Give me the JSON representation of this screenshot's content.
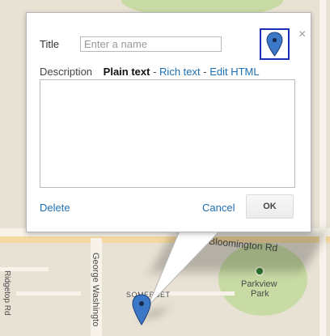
{
  "dialog": {
    "title_label": "Title",
    "title_placeholder": "Enter a name",
    "title_value": "",
    "description_label": "Description",
    "mode_plain": "Plain text",
    "separator": "-",
    "mode_rich": "Rich text",
    "mode_html": "Edit HTML",
    "description_value": "",
    "delete_label": "Delete",
    "cancel_label": "Cancel",
    "ok_label": "OK",
    "close_glyph": "×",
    "marker_icon": "map-pin-icon",
    "close_icon": "close-icon"
  },
  "map": {
    "labels": {
      "bloomington": "Bloomington Rd",
      "parkview": "Parkview",
      "park": "Park",
      "george": "George Washingto",
      "somerset": "SOMERSET",
      "ridgetop": "Ridgetop Rd"
    },
    "marker_icon": "map-pin-icon",
    "colors": {
      "pin": "#3b78c7",
      "accent_border": "#1a2fb3",
      "link": "#1d6fb3"
    }
  }
}
